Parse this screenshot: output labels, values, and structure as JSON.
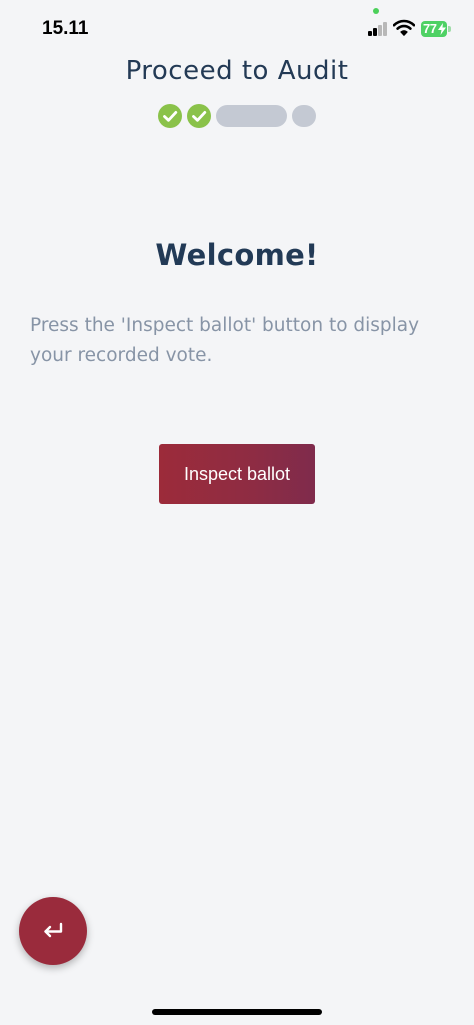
{
  "status_bar": {
    "time": "15.11",
    "battery_level": "77",
    "signal_icon": "cellular-signal-icon",
    "wifi_icon": "wifi-icon",
    "battery_icon": "battery-charging-icon"
  },
  "header": {
    "title": "Proceed to Audit",
    "progress": {
      "completed_steps": 2,
      "current_step": 3,
      "total_steps": 4
    }
  },
  "main": {
    "heading": "Welcome!",
    "instructions": "Press the 'Inspect ballot' button to display your recorded vote.",
    "inspect_button_label": "Inspect ballot"
  },
  "fab": {
    "icon": "return-arrow-icon"
  },
  "colors": {
    "background": "#f4f5f7",
    "heading": "#223a56",
    "body_text": "#8794a6",
    "step_complete": "#8ac24a",
    "step_pending": "#c4c9d3",
    "accent": "#9a2b3c"
  }
}
